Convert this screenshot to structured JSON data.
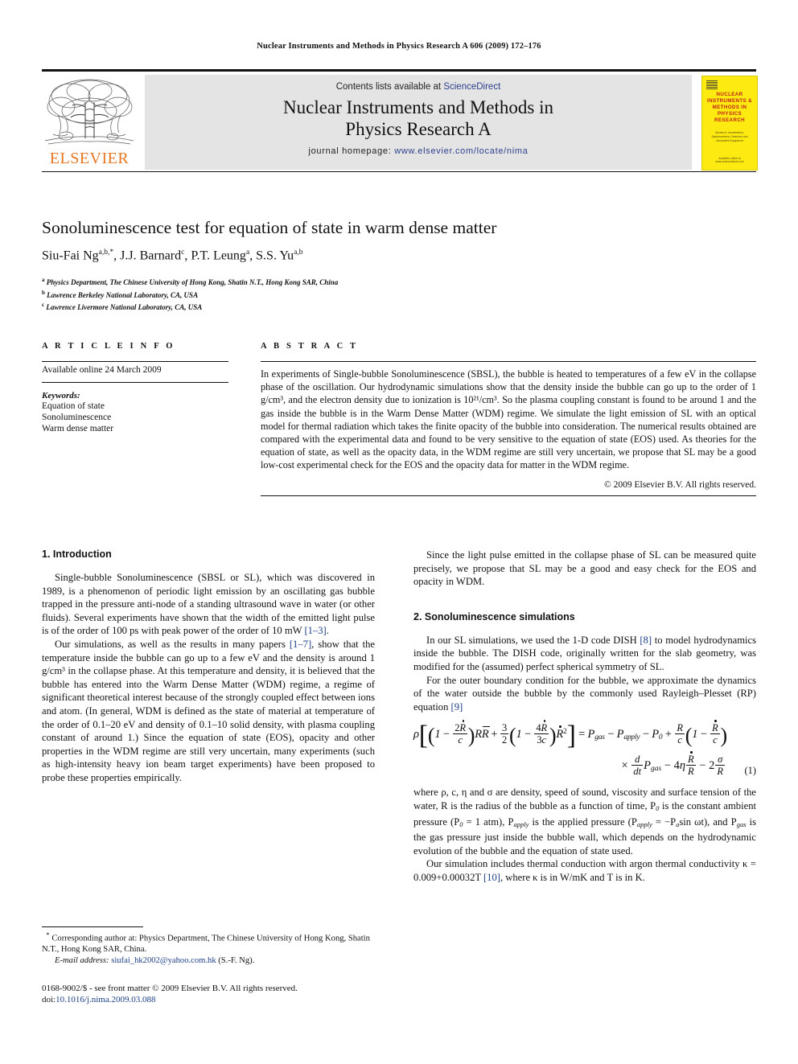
{
  "running_head": "Nuclear Instruments and Methods in Physics Research A 606 (2009) 172–176",
  "masthead": {
    "contents_prefix": "Contents lists available at ",
    "sciencedirect": "ScienceDirect",
    "journal_title_line1": "Nuclear Instruments and Methods in",
    "journal_title_line2": "Physics Research A",
    "homepage_prefix": "journal homepage: ",
    "homepage_url": "www.elsevier.com/locate/nima",
    "publisher_wordmark": "ELSEVIER",
    "publisher_color": "#e87722",
    "link_color": "#2b3f8c"
  },
  "cover": {
    "title": "NUCLEAR INSTRUMENTS & METHODS IN PHYSICS RESEARCH",
    "subtitle": "Section A: Accelerators, Spectrometers, Detectors and Associated Equipment",
    "footer": "Available online at www.sciencedirect.com",
    "background": "#fcea10",
    "title_color": "#c02020"
  },
  "article": {
    "title": "Sonoluminescence test for equation of state in warm dense matter",
    "authors": [
      {
        "name": "Siu-Fai Ng",
        "marks": "a,b,*"
      },
      {
        "name": "J.J. Barnard",
        "marks": "c"
      },
      {
        "name": "P.T. Leung",
        "marks": "a"
      },
      {
        "name": "S.S. Yu",
        "marks": "a,b"
      }
    ],
    "affiliations": [
      {
        "mark": "a",
        "text": "Physics Department, The Chinese University of Hong Kong, Shatin N.T., Hong Kong SAR, China"
      },
      {
        "mark": "b",
        "text": "Lawrence Berkeley National Laboratory, CA, USA"
      },
      {
        "mark": "c",
        "text": "Lawrence Livermore National Laboratory, CA, USA"
      }
    ]
  },
  "article_info": {
    "heading": "A R T I C L E   I N F O",
    "available_online": "Available online 24 March 2009",
    "keywords_label": "Keywords:",
    "keywords": [
      "Equation of state",
      "Sonoluminescence",
      "Warm dense matter"
    ]
  },
  "abstract": {
    "heading": "A B S T R A C T",
    "paragraphs": [
      "In experiments of Single-bubble Sonoluminescence (SBSL), the bubble is heated to temperatures of a few eV in the collapse phase of the oscillation. Our hydrodynamic simulations show that the density inside the bubble can go up to the order of 1 g/cm³, and the electron density due to ionization is 10²¹/cm³. So the plasma coupling constant is found to be around 1 and the gas inside the bubble is in the Warm Dense Matter (WDM) regime. We simulate the light emission of SL with an optical model for thermal radiation which takes the finite opacity of the bubble into consideration. The numerical results obtained are compared with the experimental data and found to be very sensitive to the equation of state (EOS) used. As theories for the equation of state, as well as the opacity data, in the WDM regime are still very uncertain, we propose that SL may be a good low-cost experimental check for the EOS and the opacity data for matter in the WDM regime."
    ],
    "copyright": "© 2009 Elsevier B.V. All rights reserved."
  },
  "sections": {
    "intro": {
      "heading": "1.  Introduction",
      "p1_a": "Single-bubble Sonoluminescence (SBSL or SL), which was discovered in 1989, is a phenomenon of periodic light emission by an oscillating gas bubble trapped in the pressure anti-node of a standing ultrasound wave in water (or other fluids). Several experiments have shown that the width of the emitted light pulse is of the order of 100 ps with peak power of the order of 10 mW ",
      "p1_ref": "[1–3]",
      "p1_b": ".",
      "p2_a": "Our simulations, as well as the results in many papers ",
      "p2_ref": "[1–7]",
      "p2_b": ", show that the temperature inside the bubble can go up to a few eV and the density is around 1 g/cm³ in the collapse phase. At this temperature and density, it is believed that the bubble has entered into the Warm Dense Matter (WDM) regime, a regime of significant theoretical interest because of the strongly coupled effect between ions and atom. (In general, WDM is defined as the state of material at temperature of the order of 0.1–20 eV and density of 0.1–10 solid density, with plasma coupling constant of around 1.) Since the equation of state (EOS), opacity and other properties in the WDM regime are still very uncertain, many experiments (such as high-intensity heavy ion beam target experiments) have been proposed to probe these properties empirically.",
      "p3": "Since the light pulse emitted in the collapse phase of SL can be measured quite precisely, we propose that SL may be a good and easy check for the EOS and opacity in WDM."
    },
    "sim": {
      "heading": "2.  Sonoluminescence simulations",
      "p1_a": "In our SL simulations, we used the 1-D code DISH ",
      "p1_ref": "[8]",
      "p1_b": " to model hydrodynamics inside the bubble. The DISH code, originally written for the slab geometry, was modified for the (assumed) perfect spherical symmetry of SL.",
      "p2_a": "For the outer boundary condition for the bubble, we approximate the dynamics of the water outside the bubble by the commonly used Rayleigh–Plesset (RP) equation ",
      "p2_ref": "[9]",
      "p3_a": "where ρ, c, η and σ are density, speed of sound, viscosity and surface tension of the water, R is the radius of the bubble as a function of time, P",
      "p3_b": " is the constant ambient pressure (P",
      "p3_c": " = 1 atm), P",
      "p3_d": " is the applied pressure (P",
      "p3_e": " = −P",
      "p3_f": "sin ωt), and P",
      "p3_g": " is the gas pressure just inside the bubble wall, which depends on the hydrodynamic evolution of the bubble and the equation of state used.",
      "p4_a": "Our simulation includes thermal conduction with argon thermal conductivity κ = 0.009+0.00032T ",
      "p4_ref": "[10]",
      "p4_b": ", where κ is in W/mK and T is in K."
    }
  },
  "equation": {
    "number": "(1)",
    "latex_like": "ρ[(1 − 2Ṙ/c)RR̈ + (3/2)(1 − 4Ṙ/3c)Ṙ²] = P_gas − P_apply − P_0 + (R/c)(1 − Ṙ/c) × (d/dt)P_gas − 4η(Ṙ/R) − 2(σ/R)"
  },
  "footnotes": {
    "corresponding_mark": "*",
    "corresponding": " Corresponding author at: Physics Department, The Chinese University of Hong Kong, Shatin N.T., Hong Kong SAR, China.",
    "email_label": "E-mail address:",
    "email": "siufai_hk2002@yahoo.com.hk",
    "email_owner": "(S.-F. Ng)."
  },
  "imprint": {
    "issn_line": "0168-9002/$ - see front matter © 2009 Elsevier B.V. All rights reserved.",
    "doi_label": "doi:",
    "doi": "10.1016/j.nima.2009.03.088"
  }
}
